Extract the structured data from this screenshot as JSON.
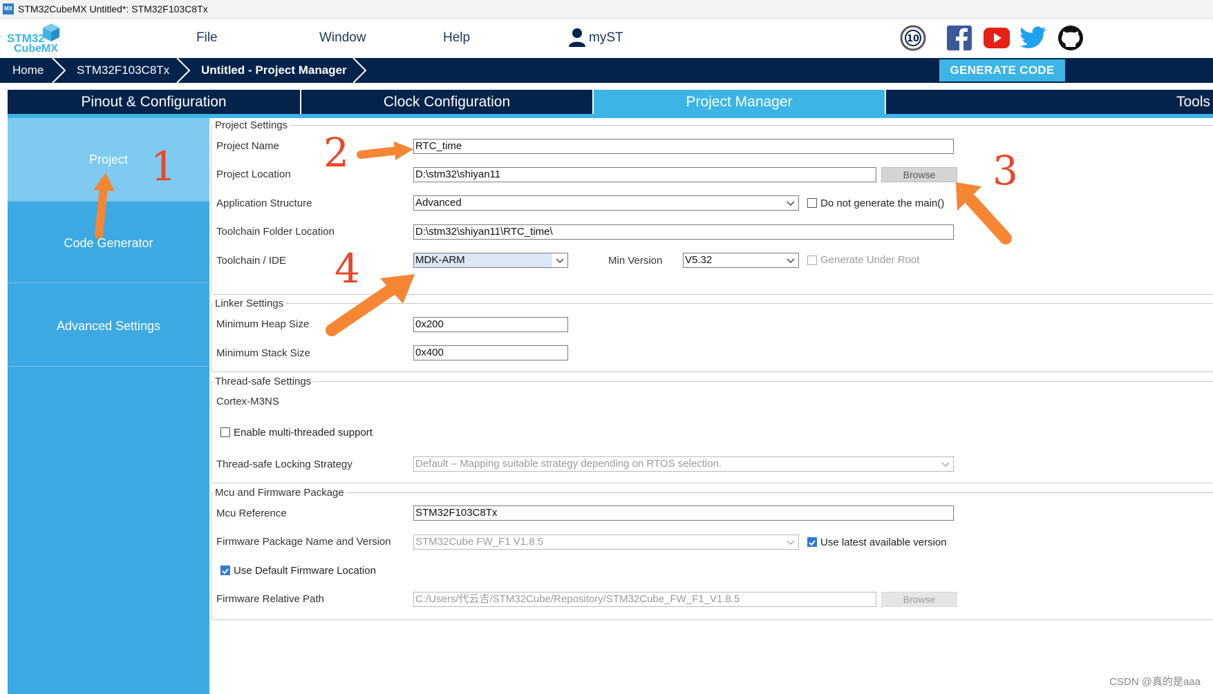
{
  "window": {
    "title": "STM32CubeMX Untitled*: STM32F103C8Tx",
    "app_icon_text": "MX"
  },
  "menu": {
    "logo_line1": "STM32",
    "logo_line2": "CubeMX",
    "file": "File",
    "window": "Window",
    "help": "Help",
    "myst": "myST"
  },
  "breadcrumb": {
    "home": "Home",
    "device": "STM32F103C8Tx",
    "current": "Untitled - Project Manager"
  },
  "generate_button": "GENERATE CODE",
  "tabs": [
    {
      "label": "Pinout & Configuration",
      "active": false
    },
    {
      "label": "Clock Configuration",
      "active": false
    },
    {
      "label": "Project Manager",
      "active": true
    },
    {
      "label": "Tools",
      "active": false
    }
  ],
  "sidebar": {
    "items": [
      {
        "label": "Project",
        "active": true
      },
      {
        "label": "Code Generator",
        "active": false
      },
      {
        "label": "Advanced Settings",
        "active": false
      }
    ]
  },
  "project_settings": {
    "legend": "Project Settings",
    "project_name_label": "Project Name",
    "project_name_value": "RTC_time",
    "project_location_label": "Project Location",
    "project_location_value": "D:\\stm32\\shiyan11",
    "browse_label": "Browse",
    "app_structure_label": "Application Structure",
    "app_structure_value": "Advanced",
    "no_main_label": "Do not generate the main()",
    "toolchain_folder_label": "Toolchain Folder Location",
    "toolchain_folder_value": "D:\\stm32\\shiyan11\\RTC_time\\",
    "toolchain_ide_label": "Toolchain / IDE",
    "toolchain_ide_value": "MDK-ARM",
    "min_version_label": "Min Version",
    "min_version_value": "V5.32",
    "generate_under_root_label": "Generate Under Root"
  },
  "linker_settings": {
    "legend": "Linker Settings",
    "heap_label": "Minimum Heap Size",
    "heap_value": "0x200",
    "stack_label": "Minimum Stack Size",
    "stack_value": "0x400"
  },
  "thread_safe": {
    "legend": "Thread-safe Settings",
    "core": "Cortex-M3NS",
    "multi_thread_label": "Enable multi-threaded support",
    "locking_label": "Thread-safe Locking Strategy",
    "locking_value": "Default  –  Mapping suitable strategy depending on RTOS selection."
  },
  "mcu_firmware": {
    "legend": "Mcu and Firmware Package",
    "mcu_ref_label": "Mcu Reference",
    "mcu_ref_value": "STM32F103C8Tx",
    "fw_name_label": "Firmware Package Name and Version",
    "fw_name_value": "STM32Cube FW_F1 V1.8.5",
    "use_latest_label": "Use latest available version",
    "use_default_fw_label": "Use Default Firmware Location",
    "fw_path_label": "Firmware Relative Path",
    "fw_path_value": "C:/Users/代云吉/STM32Cube/Repository/STM32Cube_FW_F1_V1.8.5",
    "browse_label": "Browse"
  },
  "annotations": {
    "n1": "1",
    "n2": "2",
    "n3": "3",
    "n4": "4",
    "arrow_color": "#f58634",
    "number_color": "#e8472a"
  },
  "watermark": "CSDN @真的是aaa",
  "colors": {
    "navy": "#03234b",
    "accent": "#3cb4e6",
    "sidebar": "#3ca9e2"
  }
}
